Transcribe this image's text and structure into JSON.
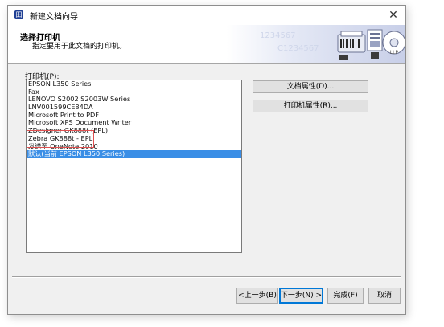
{
  "window": {
    "title": "新建文档向导",
    "close_glyph": "✕",
    "app_icon_glyph": "田"
  },
  "banner": {
    "heading": "选择打印机",
    "subheading": "指定要用于此文档的打印机。"
  },
  "printer_list": {
    "label": "打印机(P):",
    "items": [
      "EPSON L350 Series",
      "Fax",
      "LENOVO S2002 S2003W Series",
      "LNV001599CE84DA",
      "Microsoft Print to PDF",
      "Microsoft XPS Document Writer",
      "ZDesigner GK888t (EPL)",
      "Zebra GK888t - EPL",
      "发送至 OneNote 2010",
      "默认(当前 EPSON L350 Series)"
    ],
    "selected_index": 9
  },
  "buttons": {
    "document_properties": "文档属性(D)...",
    "printer_properties": "打印机属性(R)...",
    "back": "<上一步(B)",
    "next": "下一步(N) >",
    "finish": "完成(F)",
    "cancel": "取消"
  },
  "colors": {
    "selection": "#3a8ee6",
    "annotation_box": "#e05050",
    "default_button_border": "#0078d7"
  },
  "icons": {
    "app": "wizard-app-icon",
    "close": "close-icon",
    "banner_art": "printer-label-illustration"
  }
}
